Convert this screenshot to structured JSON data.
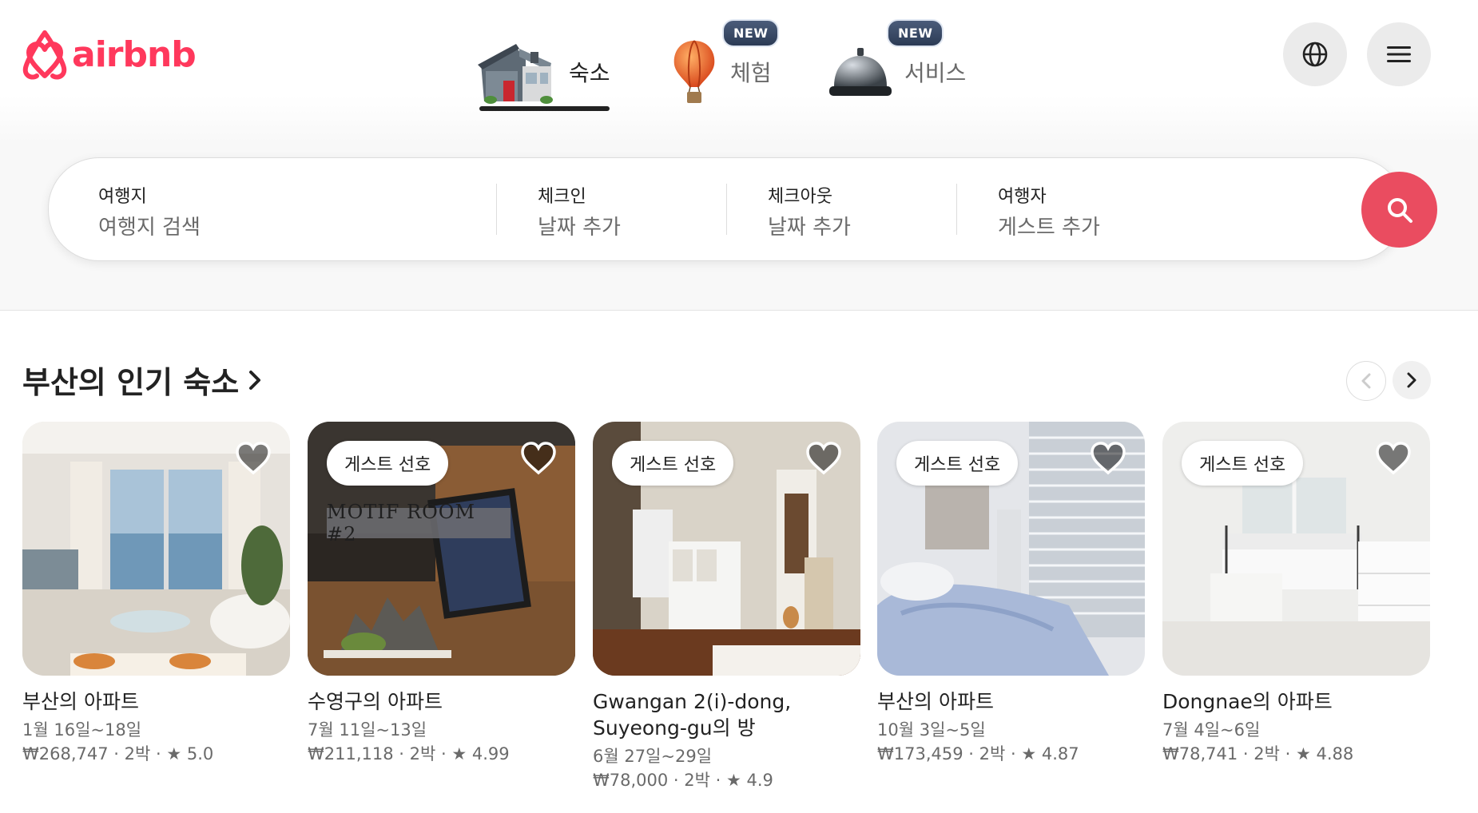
{
  "brand": {
    "name": "airbnb",
    "color": "#ff385c"
  },
  "header": {
    "tabs": [
      {
        "label": "숙소",
        "icon": "house-icon",
        "active": true
      },
      {
        "label": "체험",
        "icon": "hot-air-balloon-icon",
        "badge": "NEW"
      },
      {
        "label": "서비스",
        "icon": "service-bell-icon",
        "badge": "NEW"
      }
    ],
    "globe_icon": "globe-icon",
    "menu_icon": "hamburger-menu-icon"
  },
  "search": {
    "destination": {
      "label": "여행지",
      "placeholder": "여행지 검색"
    },
    "checkin": {
      "label": "체크인",
      "placeholder": "날짜 추가"
    },
    "checkout": {
      "label": "체크아웃",
      "placeholder": "날짜 추가"
    },
    "guests": {
      "label": "여행자",
      "placeholder": "게스트 추가"
    },
    "button_icon": "search-icon",
    "button_color": "#ea4c60"
  },
  "section": {
    "title": "부산의 인기 숙소",
    "title_arrow_icon": "chevron-right-icon",
    "prev_icon": "chevron-left-icon",
    "next_icon": "chevron-right-icon"
  },
  "listings": [
    {
      "title": "부산의 아파트",
      "dates": "1월 16일~18일",
      "price": "₩268,747 · 2박",
      "rating": "5.0",
      "badge": null
    },
    {
      "title": "수영구의 아파트",
      "dates": "7월 11일~13일",
      "price": "₩211,118 · 2박",
      "rating": "4.99",
      "badge": "게스트 선호",
      "photo_text": "MOTIF ROOM #2"
    },
    {
      "title": "Gwangan 2(i)-dong, Suyeong-gu의 방",
      "dates": "6월 27일~29일",
      "price": "₩78,000 · 2박",
      "rating": "4.9",
      "badge": "게스트 선호"
    },
    {
      "title": "부산의 아파트",
      "dates": "10월 3일~5일",
      "price": "₩173,459 · 2박",
      "rating": "4.87",
      "badge": "게스트 선호"
    },
    {
      "title": "Dongnae의 아파트",
      "dates": "7월 4일~6일",
      "price": "₩78,741 · 2박",
      "rating": "4.88",
      "badge": "게스트 선호"
    }
  ]
}
